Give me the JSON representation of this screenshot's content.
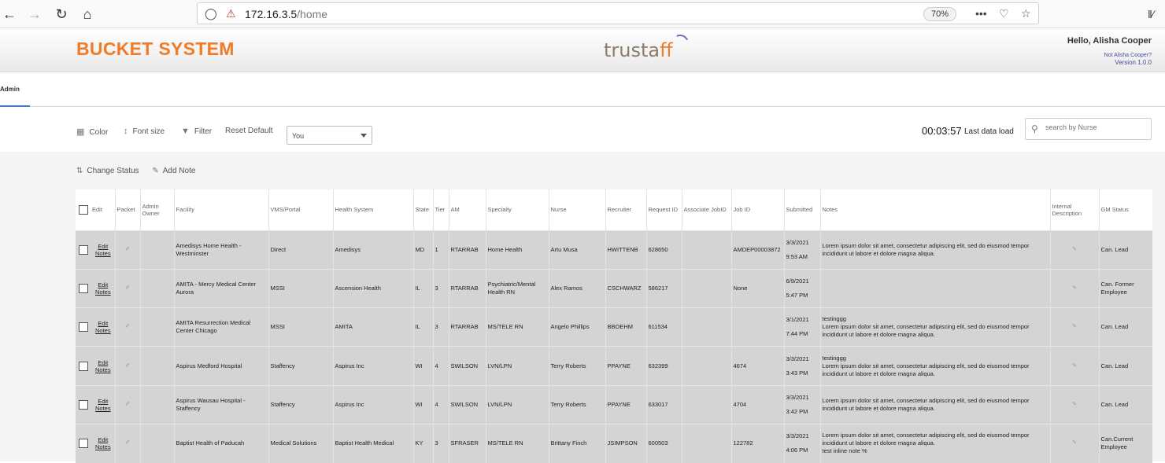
{
  "browser": {
    "url_host": "172.16.3.5",
    "url_path": "/home",
    "zoom": "70%",
    "menu_dots": "•••"
  },
  "header": {
    "title": "BUCKET SYSTEM",
    "logo_left": "trusta",
    "logo_ff": "ff",
    "greeting": "Hello, Alisha Cooper",
    "not_user": "Not Alisha Cooper?",
    "version": "Version 1.0.0"
  },
  "tabs": {
    "admin": "Admin"
  },
  "toolbar": {
    "color": "Color",
    "font_size": "Font size",
    "filter": "Filter",
    "reset_default": "Reset Default",
    "user_filter_value": "You",
    "timer": "00:03:57",
    "last_load": "Last data load",
    "search_placeholder": "search by Nurse"
  },
  "actions": {
    "change_status": "Change Status",
    "add_note": "Add Note"
  },
  "table": {
    "columns": [
      "Edit",
      "Packet",
      "Admin Owner",
      "Facility",
      "VMS/Portal",
      "Health System",
      "State",
      "Tier",
      "AM",
      "Specialty",
      "Nurse",
      "Recruiter",
      "Request ID",
      "Associate JobID",
      "Job ID",
      "Submitted",
      "Notes",
      "Internal Description",
      "GM Status"
    ],
    "edit_label": "Edit",
    "notes_label": "Notes",
    "rows": [
      {
        "facility": "Amedisys Home Health - Westminster",
        "vms": "Direct",
        "health_system": "Amedisys",
        "state": "MD",
        "tier": "1",
        "am": "RTARRAB",
        "specialty": "Home Health",
        "nurse": "Artu Musa",
        "recruiter": "HWITTENB",
        "request_id": "628650",
        "assoc_job": "",
        "job_id": "AMDEP00003872",
        "sub_date": "3/3/2021",
        "sub_time": "9:53 AM",
        "notes": "Lorem ipsum dolor sit amet, consectetur adipiscing elit, sed do eiusmod tempor incididunt ut labore et dolore magna aliqua.",
        "gm_status": "Can. Lead"
      },
      {
        "facility": "AMITA - Mercy Medical Center Aurora",
        "vms": "MSSI",
        "health_system": "Ascension Health",
        "state": "IL",
        "tier": "3",
        "am": "RTARRAB",
        "specialty": "Psychiatric/Mental Health RN",
        "nurse": "Alex Ramos",
        "recruiter": "CSCHWARZ",
        "request_id": "586217",
        "assoc_job": "",
        "job_id": "None",
        "sub_date": "6/9/2021",
        "sub_time": "5:47 PM",
        "notes": "",
        "gm_status": "Can. Former Employee"
      },
      {
        "facility": "AMITA Resurrection Medical Center Chicago",
        "vms": "MSSI",
        "health_system": "AMITA",
        "state": "IL",
        "tier": "3",
        "am": "RTARRAB",
        "specialty": "MS/TELE RN",
        "nurse": "Angelo Phillips",
        "recruiter": "BBOEHM",
        "request_id": "611534",
        "assoc_job": "",
        "job_id": "",
        "sub_date": "3/1/2021",
        "sub_time": "7:44 PM",
        "notes": "testinggg\nLorem ipsum dolor sit amet, consectetur adipiscing elit, sed do eiusmod tempor incididunt ut labore et dolore magna aliqua.",
        "gm_status": "Can. Lead"
      },
      {
        "facility": "Aspirus Medford Hospital",
        "vms": "Staffency",
        "health_system": "Aspirus Inc",
        "state": "WI",
        "tier": "4",
        "am": "SWILSON",
        "specialty": "LVN/LPN",
        "nurse": "Terry Roberts",
        "recruiter": "PPAYNE",
        "request_id": "632399",
        "assoc_job": "",
        "job_id": "4674",
        "sub_date": "3/3/2021",
        "sub_time": "3:43 PM",
        "notes": "testinggg\nLorem ipsum dolor sit amet, consectetur adipiscing elit, sed do eiusmod tempor incididunt ut labore et dolore magna aliqua.",
        "gm_status": "Can. Lead"
      },
      {
        "facility": "Aspirus Wausau Hospital - Staffency",
        "vms": "Staffency",
        "health_system": "Aspirus Inc",
        "state": "WI",
        "tier": "4",
        "am": "SWILSON",
        "specialty": "LVN/LPN",
        "nurse": "Terry Roberts",
        "recruiter": "PPAYNE",
        "request_id": "633017",
        "assoc_job": "",
        "job_id": "4704",
        "sub_date": "3/3/2021",
        "sub_time": "3:42 PM",
        "notes": "Lorem ipsum dolor sit amet, consectetur adipiscing elit, sed do eiusmod tempor incididunt ut labore et dolore magna aliqua.",
        "gm_status": "Can. Lead"
      },
      {
        "facility": "Baptist Health of Paducah",
        "vms": "Medical Solutions",
        "health_system": "Baptist Health Medical",
        "state": "KY",
        "tier": "3",
        "am": "SFRASER",
        "specialty": "MS/TELE RN",
        "nurse": "Brittany Finch",
        "recruiter": "JSIMPSON",
        "request_id": "600503",
        "assoc_job": "",
        "job_id": "122782",
        "sub_date": "3/3/2021",
        "sub_time": "4:06 PM",
        "notes": "Lorem ipsum dolor sit amet, consectetur adipiscing elit, sed do eiusmod tempor incididunt ut labore et dolore magna aliqua.\ntest inline note %",
        "gm_status": "Can.Current Employee"
      }
    ]
  }
}
